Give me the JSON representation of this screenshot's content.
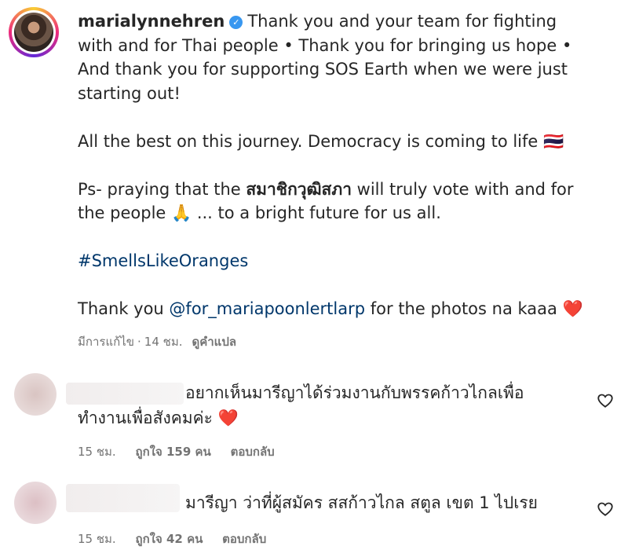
{
  "post": {
    "username": "marialynnehren",
    "line1": "Thank you and your team for fighting with and for Thai people • Thank you for bringing us hope • And thank you for supporting SOS Earth when we were just starting out!",
    "line2": "All the best on this journey. Democracy is coming to life 🇹🇭",
    "line3_pre": "Ps- praying that the ",
    "line3_bold": "สมาชิกวุฒิสภา",
    "line3_post": " will truly vote with and for the people 🙏 ... to a bright future for us all.",
    "hashtag": "#SmellsLikeOranges",
    "line5_pre": "Thank you ",
    "mention": "@for_mariapoonlertlarp",
    "line5_post": " for the photos na kaaa",
    "heart": "❤️",
    "edited": "มีการแก้ไข",
    "dot": "·",
    "time": "14 ชม.",
    "translate": "ดูคำแปล"
  },
  "replies": [
    {
      "text": "อยากเห็นมารีญาได้ร่วมงานกับพรรคก้าวไกลเพื่อทำงานเพื่อสังคมค่ะ",
      "heart": "❤️",
      "time": "15 ชม.",
      "likes": "ถูกใจ 159 คน",
      "reply": "ตอบกลับ",
      "avatar_color": "#e6d3d1"
    },
    {
      "text": "มารีญา ว่าที่ผู้สมัคร สสก้าวไกล สตูล เขต 1 ไปเรย",
      "time": "15 ชม.",
      "likes": "ถูกใจ 42 คน",
      "reply": "ตอบกลับ",
      "avatar_color": "#e9d0d4"
    }
  ],
  "icons": {
    "verified": "verified-badge-icon",
    "like": "heart-outline-icon"
  },
  "colors": {
    "link": "#00376b",
    "verified": "#3897f0",
    "heart": "#e02a3c",
    "meta": "#737373"
  }
}
